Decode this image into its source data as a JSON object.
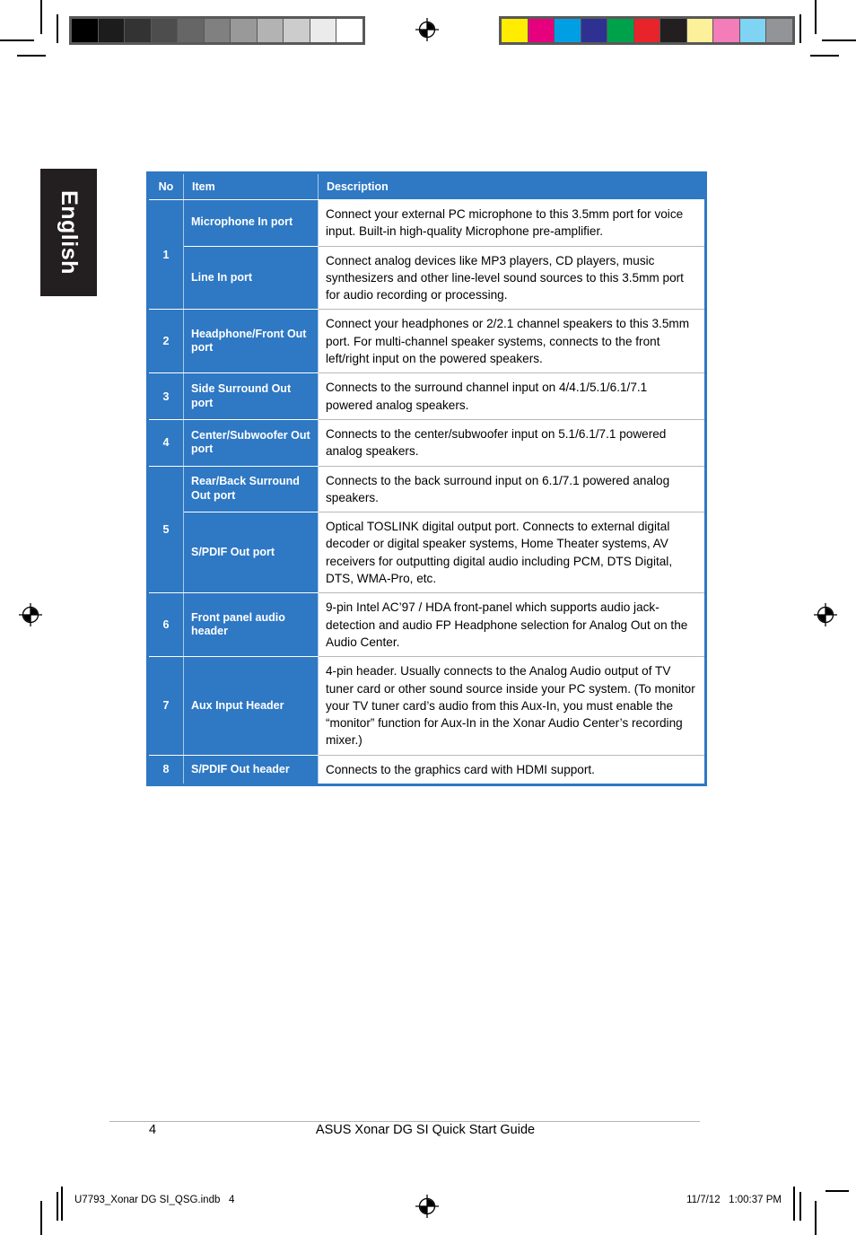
{
  "page": {
    "language_tab": "English",
    "page_number": "4",
    "footer_title": "ASUS Xonar DG SI Quick Start Guide"
  },
  "slug": {
    "filename": "U7793_Xonar DG SI_QSG.indb   4",
    "timestamp": "11/7/12   1:00:37 PM"
  },
  "colors": {
    "table_blue": "#2e78c4",
    "table_rule": "#b8b8b8",
    "tab_black": "#231f20",
    "header_divider": "#a9c9e8"
  },
  "calibration": {
    "grayscale": [
      "#000000",
      "#1c1c1c",
      "#333333",
      "#4d4d4d",
      "#666666",
      "#808080",
      "#999999",
      "#b3b3b3",
      "#cccccc",
      "#ebebeb",
      "#ffffff"
    ],
    "colorbars": [
      "#ffec00",
      "#e6007e",
      "#009fe3",
      "#2e3192",
      "#00a14b",
      "#e8232a",
      "#231f20",
      "#fdf09a",
      "#f47cb9",
      "#7fd4f4",
      "#929497"
    ]
  },
  "table": {
    "headers": {
      "no": "No",
      "item": "Item",
      "description": "Description"
    },
    "rows": [
      {
        "no": "1",
        "no_rowspan": 2,
        "items": [
          {
            "item": "Microphone In port",
            "description": "Connect your external PC microphone to this 3.5mm port for voice input. Built-in high-quality Microphone pre-amplifier."
          },
          {
            "item": "Line In port",
            "description": "Connect analog devices like MP3 players, CD players, music synthesizers and other line-level sound sources to this 3.5mm port for audio recording or processing."
          }
        ]
      },
      {
        "no": "2",
        "no_rowspan": 1,
        "items": [
          {
            "item": "Headphone/Front Out port",
            "description": "Connect your headphones or 2/2.1 channel speakers to this 3.5mm port. For multi-channel speaker systems, connects to the front left/right input on the powered speakers."
          }
        ]
      },
      {
        "no": "3",
        "no_rowspan": 1,
        "items": [
          {
            "item": "Side Surround Out port",
            "description": "Connects to the surround channel input on 4/4.1/5.1/6.1/7.1 powered analog speakers."
          }
        ]
      },
      {
        "no": "4",
        "no_rowspan": 1,
        "items": [
          {
            "item": "Center/Subwoofer Out port",
            "description": "Connects to the center/subwoofer input on 5.1/6.1/7.1 powered analog speakers."
          }
        ]
      },
      {
        "no": "5",
        "no_rowspan": 2,
        "items": [
          {
            "item": "Rear/Back Surround Out port",
            "description": "Connects to the back surround input on 6.1/7.1 powered analog speakers."
          },
          {
            "item": "S/PDIF Out port",
            "description": "Optical TOSLINK digital output port. Connects to external digital decoder or digital speaker systems, Home Theater systems, AV receivers for outputting digital audio including PCM, DTS Digital, DTS, WMA-Pro, etc."
          }
        ]
      },
      {
        "no": "6",
        "no_rowspan": 1,
        "items": [
          {
            "item": "Front panel audio header",
            "description": "9-pin Intel AC’97 / HDA front-panel which supports audio jack-detection and audio FP Headphone selection for Analog Out on the Audio Center."
          }
        ]
      },
      {
        "no": "7",
        "no_rowspan": 1,
        "items": [
          {
            "item": "Aux Input Header",
            "description": "4-pin header. Usually connects to the Analog Audio output of TV tuner card or other sound source inside your PC system. (To monitor your TV tuner card’s audio from this Aux-In, you must enable the “monitor” function for Aux-In in the Xonar Audio Center’s recording mixer.)"
          }
        ]
      },
      {
        "no": "8",
        "no_rowspan": 1,
        "items": [
          {
            "item": "S/PDIF Out header",
            "description": "Connects to the graphics card with HDMI support."
          }
        ]
      }
    ]
  }
}
